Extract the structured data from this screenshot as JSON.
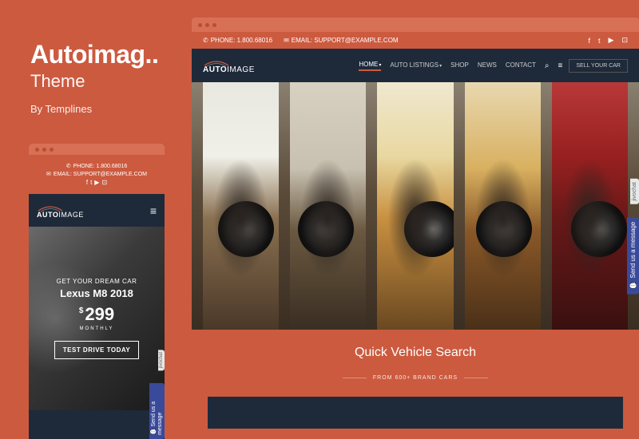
{
  "title": {
    "name": "Autoimag..",
    "subtitle": "Theme",
    "author": "By Templines"
  },
  "topbar": {
    "phone_label": "PHONE: 1.800.68016",
    "email_label": "EMAIL: SUPPORT@EXAMPLE.COM"
  },
  "logo": {
    "brand": "AUTO",
    "suffix": "IMAGE"
  },
  "nav": {
    "items": [
      {
        "label": "HOME",
        "active": true,
        "chevron": true
      },
      {
        "label": "AUTO LISTINGS",
        "active": false,
        "chevron": true
      },
      {
        "label": "SHOP",
        "active": false,
        "chevron": false
      },
      {
        "label": "NEWS",
        "active": false,
        "chevron": false
      },
      {
        "label": "CONTACT",
        "active": false,
        "chevron": false
      }
    ],
    "sell_btn": "SELL YOUR CAR"
  },
  "search": {
    "title": "Quick Vehicle Search",
    "sub": "FROM 600+ BRAND CARS"
  },
  "jivo": {
    "msg": "Send us a message",
    "label": "jivochat"
  },
  "mobile": {
    "phone": "PHONE: 1.800.68016",
    "email": "EMAIL: SUPPORT@EXAMPLE.COM",
    "tag": "GET YOUR DREAM CAR",
    "model": "Lexus M8 2018",
    "currency": "$",
    "price": "299",
    "monthly": "MONTHLY",
    "cta": "TEST DRIVE TODAY"
  },
  "icons": {
    "phone": "✆",
    "email": "✉",
    "facebook": "f",
    "twitter": "t",
    "youtube": "▶",
    "instagram": "⊡",
    "search": "⌕",
    "menu": "≡",
    "chat": "💬",
    "chevron": "▾",
    "hamburger": "≡"
  }
}
